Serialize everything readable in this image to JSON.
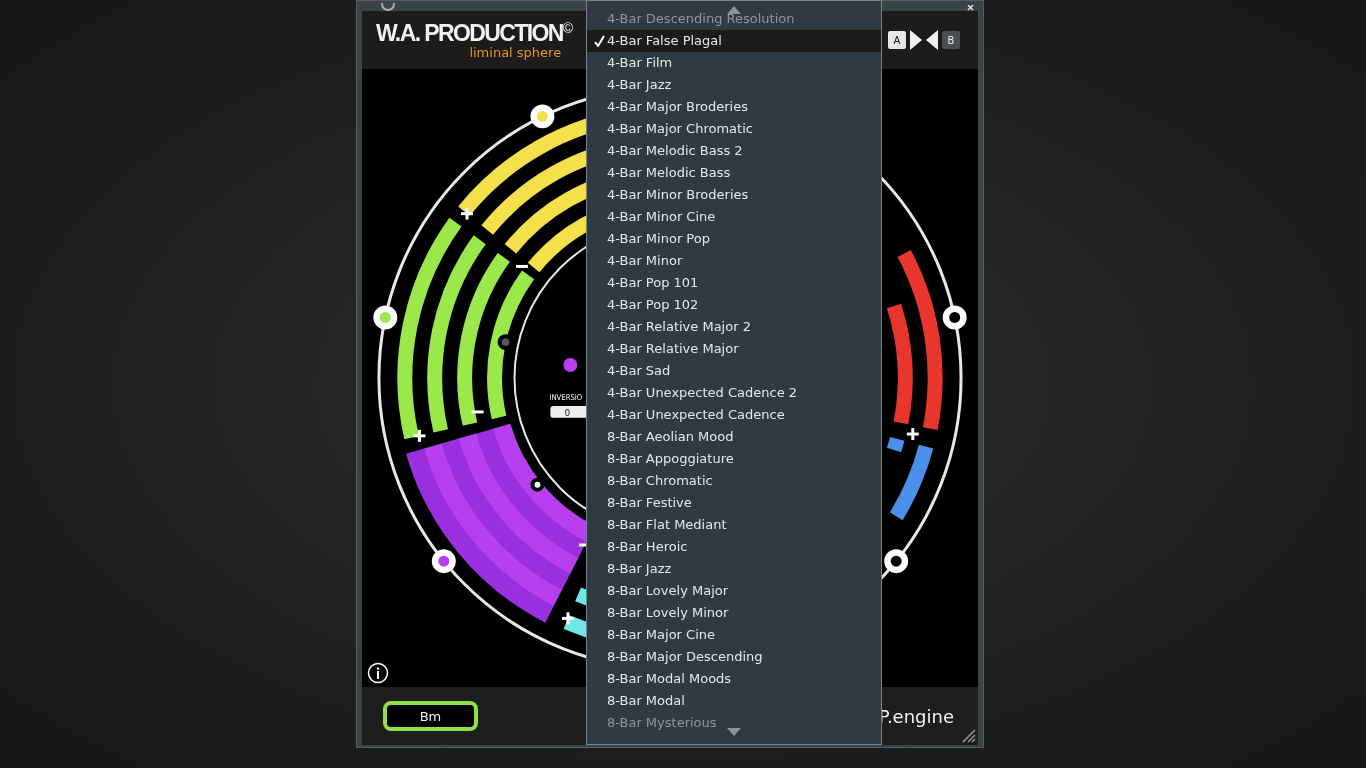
{
  "header": {
    "logo_title": "W.A. PRODUCTION",
    "logo_mark": "©",
    "logo_subtitle": "liminal sphere",
    "compare_a": "A",
    "compare_b": "B"
  },
  "wheel": {
    "inversion_label": "INVERSIO",
    "inversion_value": "0"
  },
  "footer": {
    "chord": "Bm",
    "engine_label": "P.engine"
  },
  "preset_menu": {
    "items": [
      {
        "label": "4-Bar Descending Resolution",
        "selected": false,
        "faded": true
      },
      {
        "label": "4-Bar False Plagal",
        "selected": true,
        "faded": false
      },
      {
        "label": "4-Bar Film",
        "selected": false,
        "faded": false
      },
      {
        "label": "4-Bar Jazz",
        "selected": false,
        "faded": false
      },
      {
        "label": "4-Bar Major Broderies",
        "selected": false,
        "faded": false
      },
      {
        "label": "4-Bar Major Chromatic",
        "selected": false,
        "faded": false
      },
      {
        "label": "4-Bar Melodic Bass 2",
        "selected": false,
        "faded": false
      },
      {
        "label": "4-Bar Melodic Bass",
        "selected": false,
        "faded": false
      },
      {
        "label": "4-Bar Minor Broderies",
        "selected": false,
        "faded": false
      },
      {
        "label": "4-Bar Minor Cine",
        "selected": false,
        "faded": false
      },
      {
        "label": "4-Bar Minor Pop",
        "selected": false,
        "faded": false
      },
      {
        "label": "4-Bar Minor",
        "selected": false,
        "faded": false
      },
      {
        "label": "4-Bar Pop 101",
        "selected": false,
        "faded": false
      },
      {
        "label": "4-Bar Pop 102",
        "selected": false,
        "faded": false
      },
      {
        "label": "4-Bar Relative Major 2",
        "selected": false,
        "faded": false
      },
      {
        "label": "4-Bar Relative Major",
        "selected": false,
        "faded": false
      },
      {
        "label": "4-Bar Sad",
        "selected": false,
        "faded": false
      },
      {
        "label": "4-Bar Unexpected Cadence 2",
        "selected": false,
        "faded": false
      },
      {
        "label": "4-Bar Unexpected Cadence",
        "selected": false,
        "faded": false
      },
      {
        "label": "8-Bar Aeolian Mood",
        "selected": false,
        "faded": false
      },
      {
        "label": "8-Bar Appoggiature",
        "selected": false,
        "faded": false
      },
      {
        "label": "8-Bar Chromatic",
        "selected": false,
        "faded": false
      },
      {
        "label": "8-Bar Festive",
        "selected": false,
        "faded": false
      },
      {
        "label": "8-Bar Flat Mediant",
        "selected": false,
        "faded": false
      },
      {
        "label": "8-Bar Heroic",
        "selected": false,
        "faded": false
      },
      {
        "label": "8-Bar Jazz",
        "selected": false,
        "faded": false
      },
      {
        "label": "8-Bar Lovely Major",
        "selected": false,
        "faded": false
      },
      {
        "label": "8-Bar Lovely Minor",
        "selected": false,
        "faded": false
      },
      {
        "label": "8-Bar Major Cine",
        "selected": false,
        "faded": false
      },
      {
        "label": "8-Bar Major Descending",
        "selected": false,
        "faded": false
      },
      {
        "label": "8-Bar Modal Moods",
        "selected": false,
        "faded": false
      },
      {
        "label": "8-Bar Modal",
        "selected": false,
        "faded": false
      },
      {
        "label": "8-Bar Mysterious",
        "selected": false,
        "faded": true
      }
    ]
  }
}
